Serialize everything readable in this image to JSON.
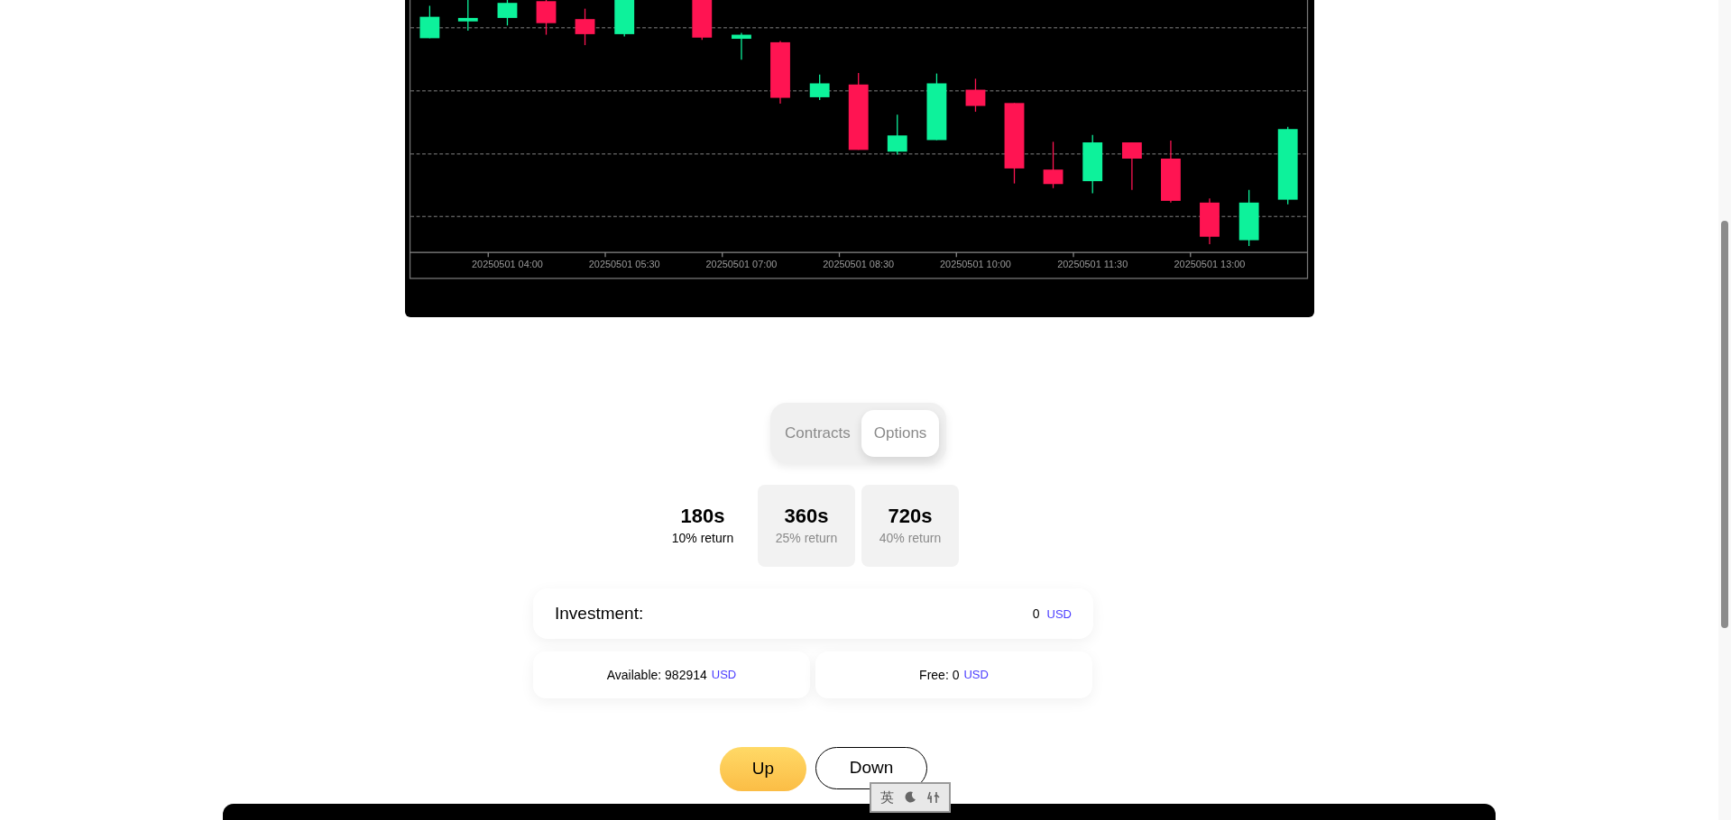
{
  "chart": {
    "x_labels": [
      "20250501 04:00",
      "20250501 05:30",
      "20250501 07:00",
      "20250501 08:30",
      "20250501 10:00",
      "20250501 11:30",
      "20250501 13:00"
    ]
  },
  "mode_tabs": [
    {
      "label": "Contracts",
      "selected": false
    },
    {
      "label": "Options",
      "selected": true
    }
  ],
  "durations": [
    {
      "time": "180s",
      "return": "10% return",
      "selected": true
    },
    {
      "time": "360s",
      "return": "25% return",
      "selected": false
    },
    {
      "time": "720s",
      "return": "40% return",
      "selected": false
    }
  ],
  "investment": {
    "label": "Investment:",
    "value": "0",
    "currency": "USD"
  },
  "balances": [
    {
      "label": "Available:",
      "value": "982914",
      "currency": "USD"
    },
    {
      "label": "Free:",
      "value": "0",
      "currency": "USD"
    }
  ],
  "buttons": [
    {
      "label": "Up",
      "kind": "primary"
    },
    {
      "label": "Down",
      "kind": "outline"
    }
  ],
  "ime_bar": {
    "mode": "英"
  }
}
